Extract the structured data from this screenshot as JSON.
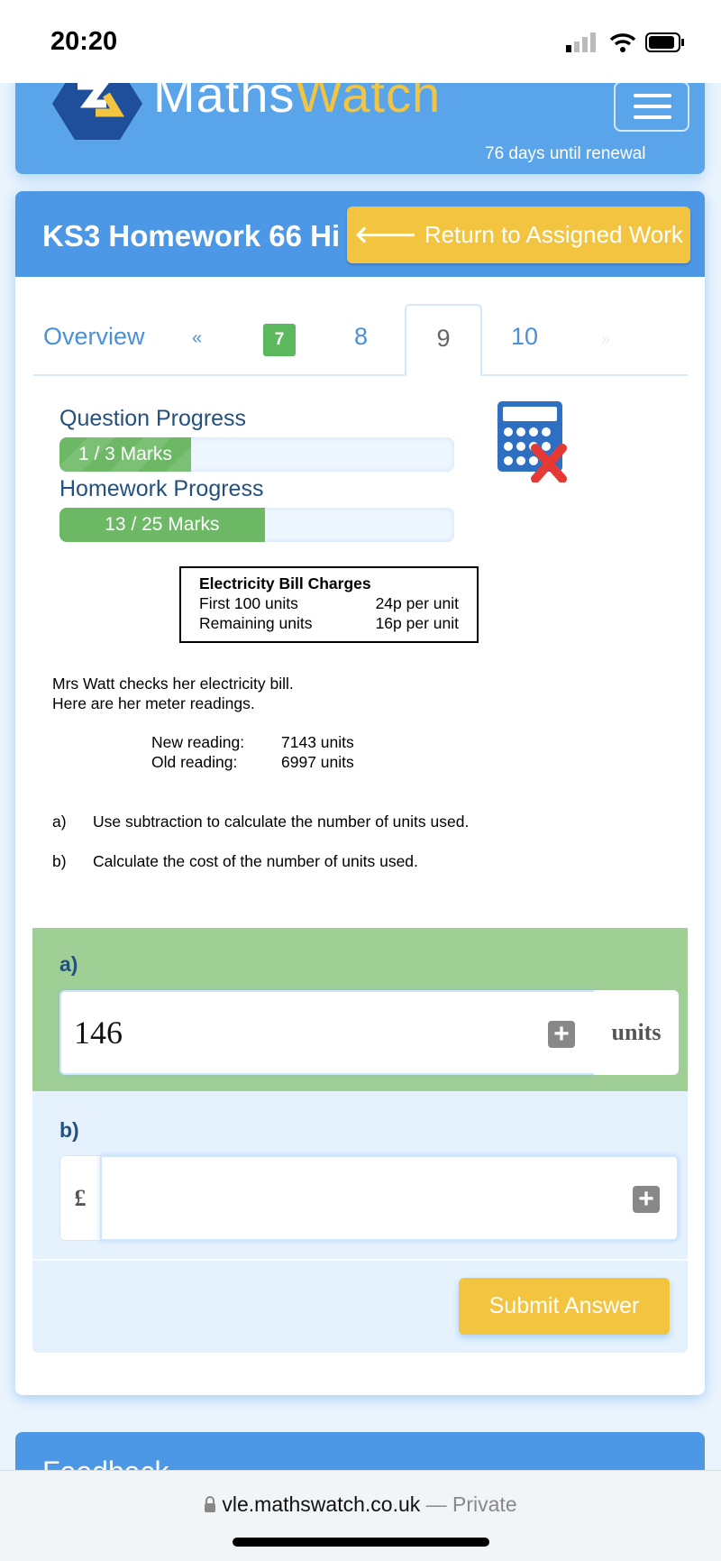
{
  "status_bar": {
    "time": "20:20"
  },
  "header": {
    "brand_part1": "Maths",
    "brand_part2": "Watch",
    "renewal": "76 days until renewal",
    "brand_color": "#f2c440",
    "header_color": "#5aa5ea"
  },
  "homework": {
    "title": "KS3 Homework 66 Hi",
    "return_label": "Return to Assigned Work"
  },
  "tabs": {
    "overview": "Overview",
    "prev": "«",
    "items": [
      "7",
      "8",
      "9",
      "10"
    ],
    "next": "»",
    "active": "9",
    "completed": "7"
  },
  "progress": {
    "question_label": "Question Progress",
    "question_text": "1 / 3 Marks",
    "question_fraction": 0.333,
    "homework_label": "Homework Progress",
    "homework_text": "13 / 25 Marks",
    "homework_fraction": 0.52
  },
  "calculator": {
    "icon": "calculator-not-allowed-icon"
  },
  "charges_table": {
    "title": "Electricity Bill Charges",
    "rows": [
      [
        "First 100 units",
        "24p per unit"
      ],
      [
        "Remaining units",
        "16p per unit"
      ]
    ]
  },
  "question": {
    "intro1": "Mrs Watt checks her electricity bill.",
    "intro2": "Here are her meter readings.",
    "readings": [
      [
        "New reading:",
        "7143 units"
      ],
      [
        "Old reading:",
        "6997 units"
      ]
    ],
    "parts": [
      [
        "a)",
        "Use subtraction to calculate the number of units used."
      ],
      [
        "b)",
        "Calculate the cost of the number of units used."
      ]
    ]
  },
  "answers": {
    "a": {
      "label": "a)",
      "value": "146",
      "unit": "units",
      "status": "correct"
    },
    "b": {
      "label": "b)",
      "prefix": "£",
      "value": ""
    },
    "submit": "Submit Answer"
  },
  "feedback": {
    "title": "Feedback"
  },
  "browser": {
    "url": "vle.mathswatch.co.uk",
    "mode": "— Private"
  }
}
